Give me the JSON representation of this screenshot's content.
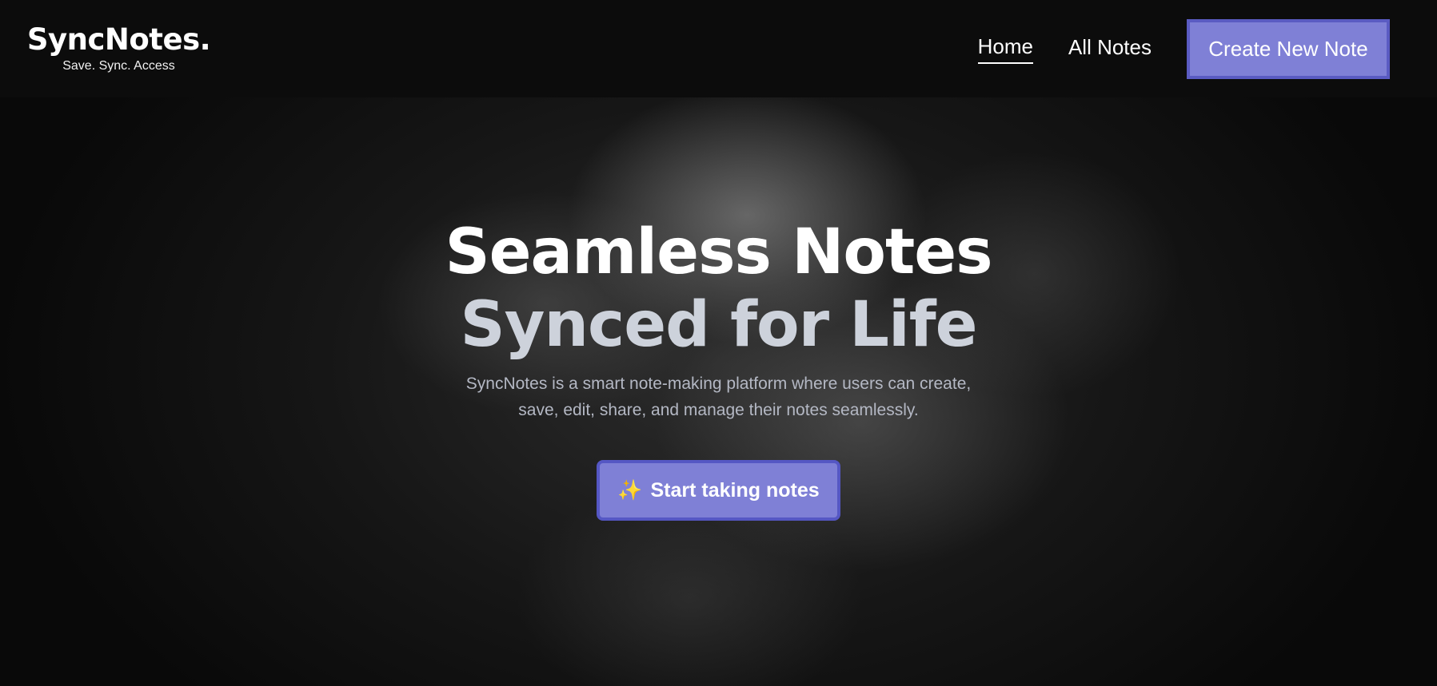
{
  "navbar": {
    "brand": {
      "name": "SyncNotes.",
      "tagline": "Save. Sync. Access"
    },
    "links": [
      {
        "label": "Home",
        "active": true
      },
      {
        "label": "All Notes",
        "active": false
      }
    ],
    "cta_label": "Create New Note"
  },
  "hero": {
    "title": "Seamless Notes",
    "subtitle": "Synced for Life",
    "description": "SyncNotes is a smart note-making platform where users can create, save, edit, share, and manage their notes seamlessly.",
    "button": {
      "icon": "sparkles-icon",
      "icon_glyph": "✨",
      "label": "Start taking notes"
    }
  },
  "colors": {
    "accent": "#7f80d6",
    "accent_border": "#5a5bc2",
    "background": "#0b0b0b",
    "subtitle": "#cdd2db",
    "description": "#b4b8c4"
  }
}
